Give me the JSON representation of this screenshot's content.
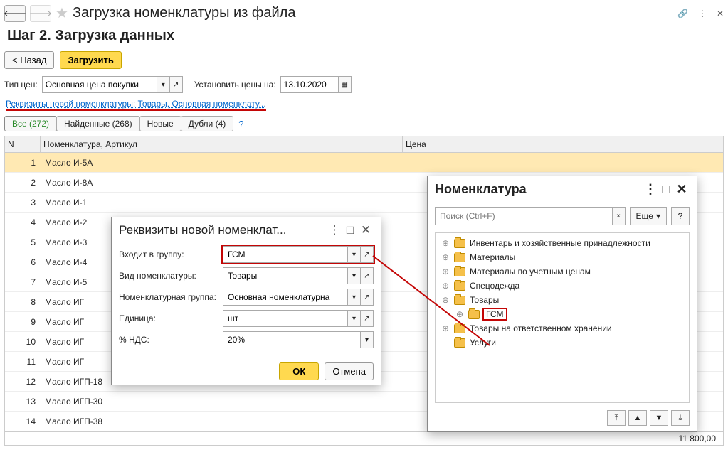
{
  "header": {
    "title": "Загрузка номенклатуры из файла",
    "step_title": "Шаг 2. Загрузка данных",
    "back_label": "< Назад",
    "load_label": "Загрузить"
  },
  "filters": {
    "price_type_label": "Тип цен:",
    "price_type_value": "Основная цена покупки",
    "set_prices_label": "Установить цены на:",
    "date_value": "13.10.2020"
  },
  "req_link": "Реквизиты новой номенклатуры: Товары, Основная номенклату...",
  "tabs": {
    "all": "Все (272)",
    "found": "Найденные (268)",
    "new": "Новые",
    "dupes": "Дубли (4)"
  },
  "table": {
    "col_n": "N",
    "col_nom": "Номенклатура, Артикул",
    "col_price": "Цена",
    "rows": [
      {
        "n": "1",
        "name": "Масло И-5А"
      },
      {
        "n": "2",
        "name": "Масло И-8А"
      },
      {
        "n": "3",
        "name": "Масло И-1"
      },
      {
        "n": "4",
        "name": "Масло И-2"
      },
      {
        "n": "5",
        "name": "Масло И-3"
      },
      {
        "n": "6",
        "name": "Масло И-4"
      },
      {
        "n": "7",
        "name": "Масло И-5"
      },
      {
        "n": "8",
        "name": "Масло ИГ"
      },
      {
        "n": "9",
        "name": "Масло ИГ"
      },
      {
        "n": "10",
        "name": "Масло ИГ"
      },
      {
        "n": "11",
        "name": "Масло ИГ"
      },
      {
        "n": "12",
        "name": "Масло ИГП-18"
      },
      {
        "n": "13",
        "name": "Масло ИГП-30"
      },
      {
        "n": "14",
        "name": "Масло ИГП-38"
      }
    ],
    "footer_total": "11 800,00"
  },
  "dialog": {
    "title": "Реквизиты новой номенклат...",
    "group_label": "Входит в группу:",
    "group_value": "ГСМ",
    "kind_label": "Вид номенклатуры:",
    "kind_value": "Товары",
    "nomgroup_label": "Номенклатурная группа:",
    "nomgroup_value": "Основная номенклатурна",
    "unit_label": "Единица:",
    "unit_value": "шт",
    "vat_label": "% НДС:",
    "vat_value": "20%",
    "ok": "ОК",
    "cancel": "Отмена"
  },
  "popup": {
    "title": "Номенклатура",
    "search_placeholder": "Поиск (Ctrl+F)",
    "more": "Еще",
    "help": "?",
    "items": [
      {
        "label": "Инвентарь и хозяйственные принадлежности",
        "exp": "⊕"
      },
      {
        "label": "Материалы",
        "exp": "⊕"
      },
      {
        "label": "Материалы по учетным ценам",
        "exp": "⊕"
      },
      {
        "label": "Спецодежда",
        "exp": "⊕"
      },
      {
        "label": "Товары",
        "exp": "⊖"
      },
      {
        "label": "ГСМ",
        "exp": "⊕",
        "indent": true,
        "hi": true
      },
      {
        "label": "Товары на ответственном хранении",
        "exp": "⊕"
      },
      {
        "label": "Услуги",
        "exp": ""
      }
    ]
  }
}
